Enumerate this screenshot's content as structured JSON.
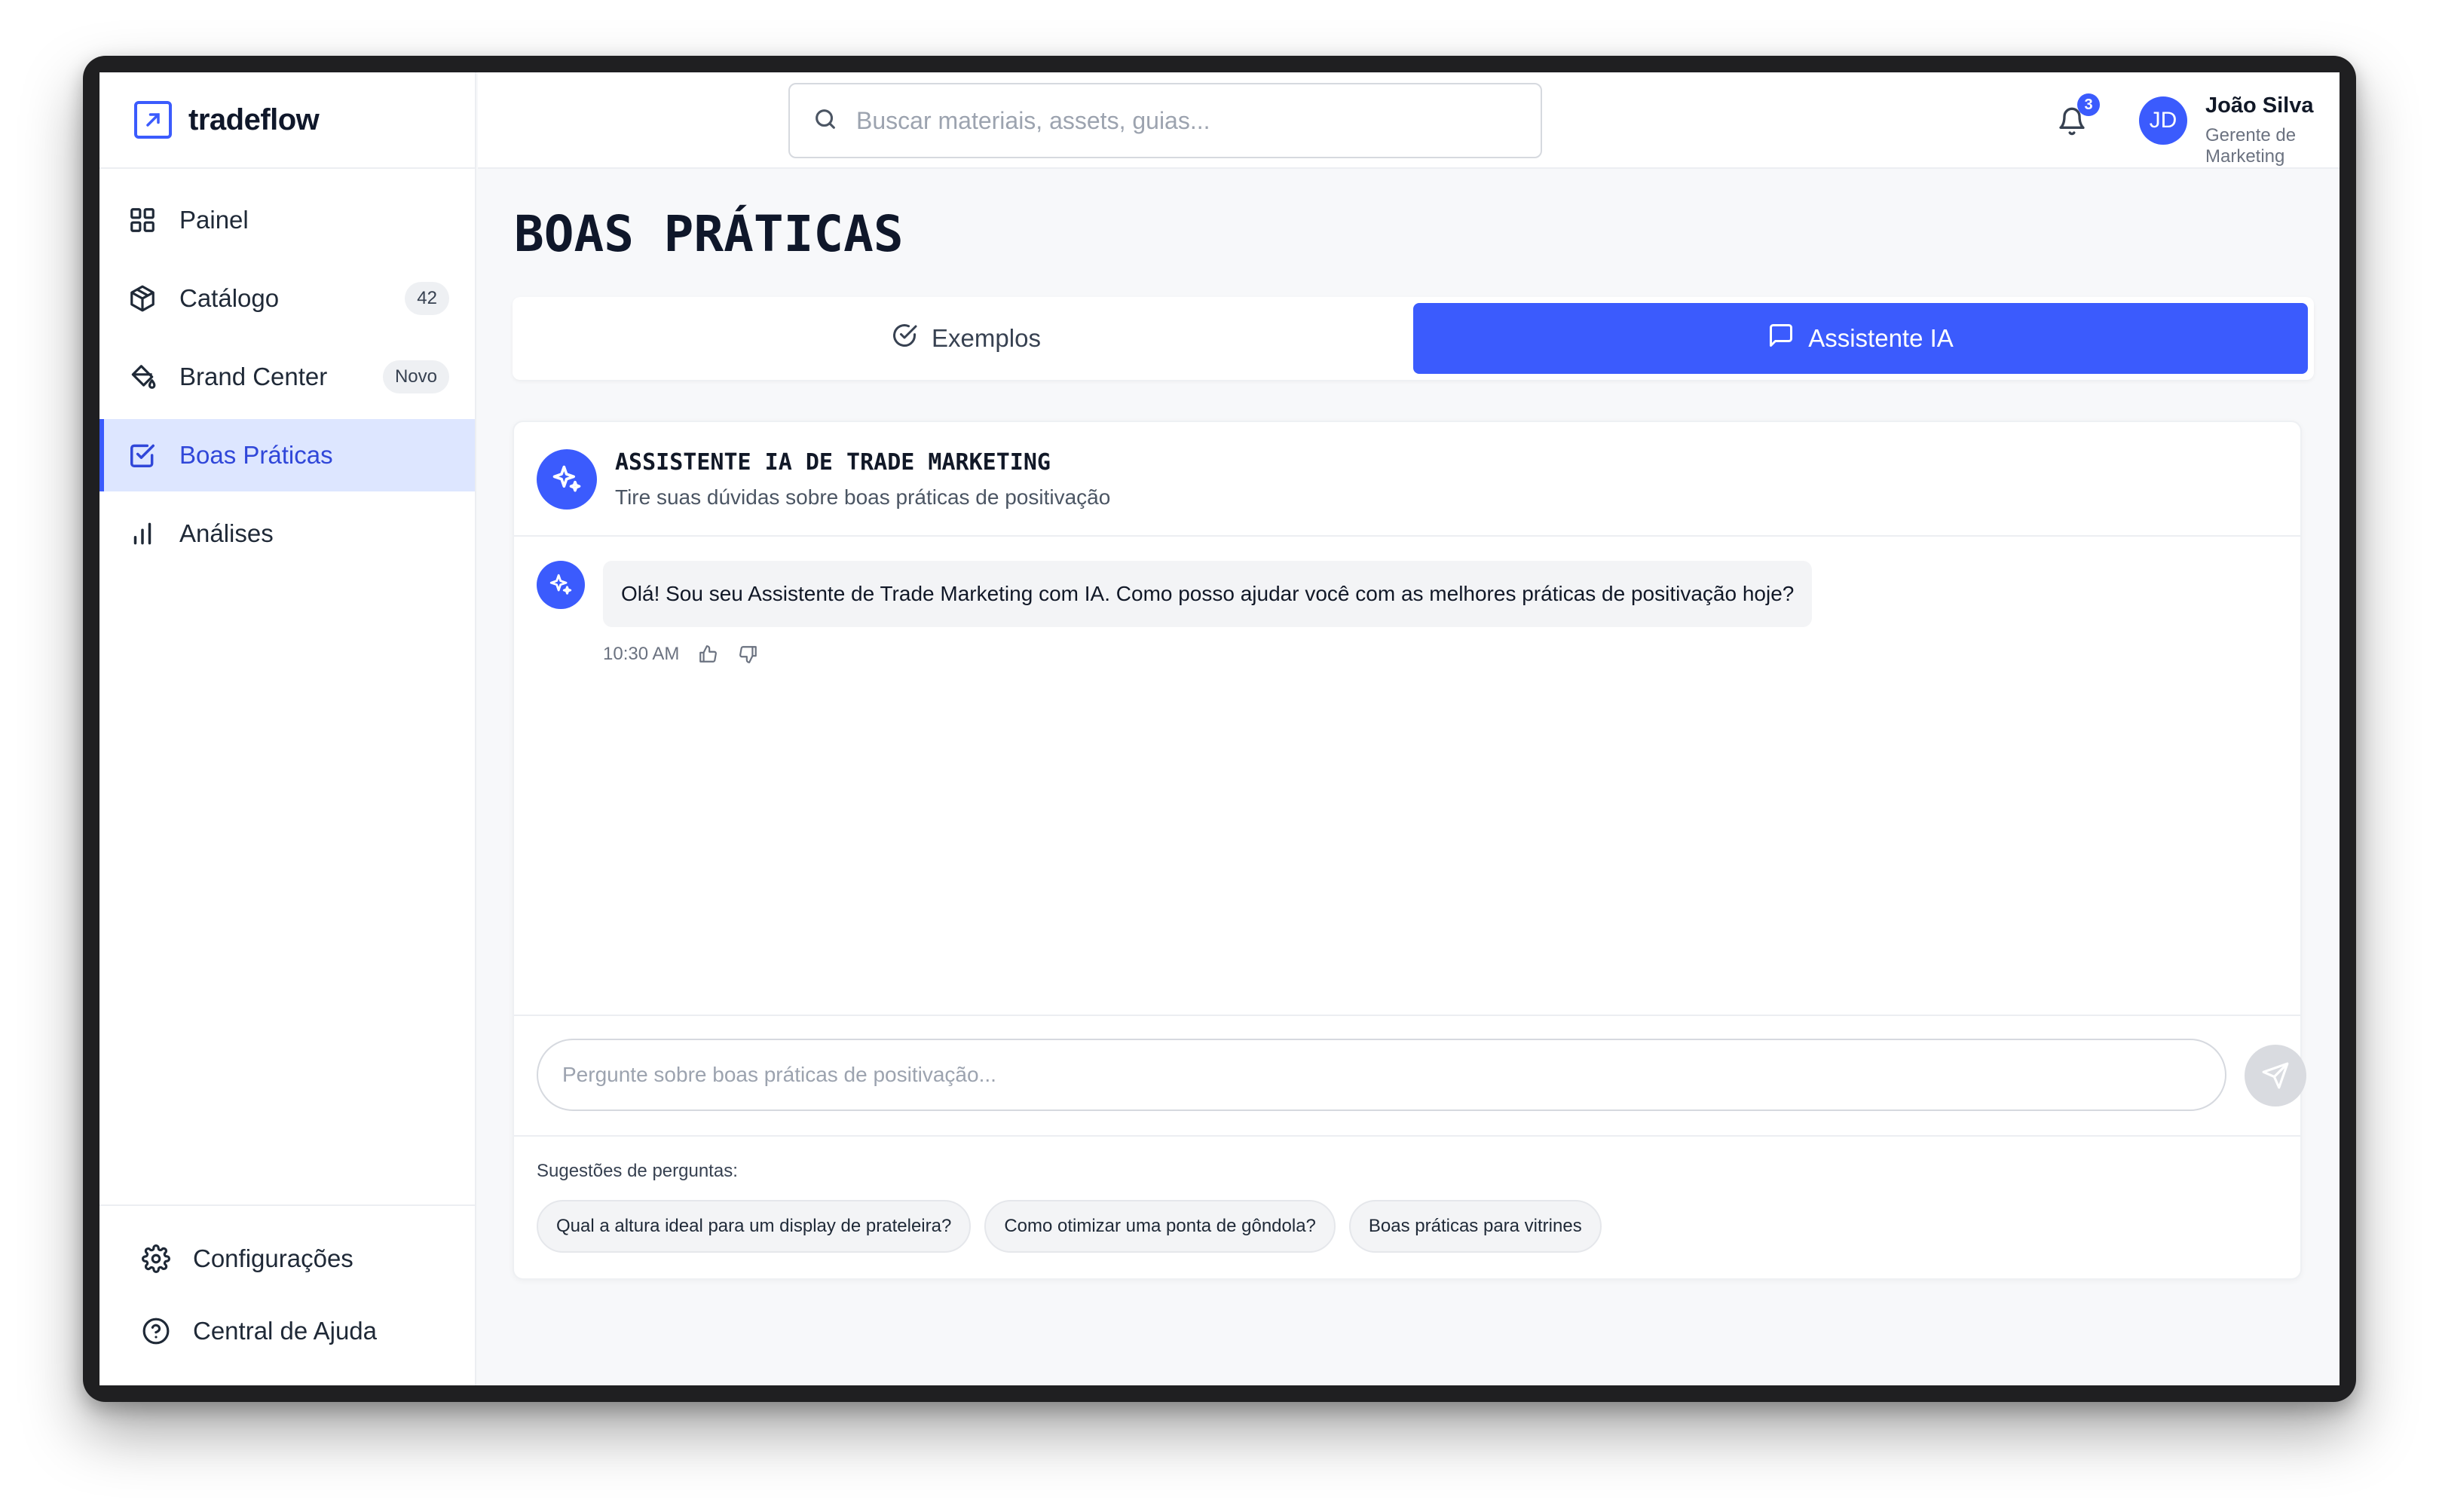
{
  "app": {
    "name": "tradeflow"
  },
  "sidebar": {
    "items": [
      {
        "label": "Painel",
        "icon": "grid-icon",
        "badge": ""
      },
      {
        "label": "Catálogo",
        "icon": "box-icon",
        "badge": "42"
      },
      {
        "label": "Brand Center",
        "icon": "paint-bucket-icon",
        "badge": "Novo"
      },
      {
        "label": "Boas Práticas",
        "icon": "check-square-icon",
        "badge": "",
        "active": true
      },
      {
        "label": "Análises",
        "icon": "bar-chart-icon",
        "badge": ""
      }
    ],
    "bottom": [
      {
        "label": "Configurações",
        "icon": "gear-icon"
      },
      {
        "label": "Central de Ajuda",
        "icon": "help-circle-icon"
      }
    ]
  },
  "header": {
    "search_placeholder": "Buscar materiais, assets, guias...",
    "notifications": "3",
    "user": {
      "initials": "JD",
      "name": "João Silva",
      "role": "Gerente de Marketing"
    }
  },
  "page": {
    "title": "BOAS PRÁTICAS"
  },
  "tabs": [
    {
      "label": "Exemplos",
      "icon": "check-circle-icon",
      "active": false
    },
    {
      "label": "Assistente IA",
      "icon": "message-square-icon",
      "active": true
    }
  ],
  "assistant": {
    "title": "ASSISTENTE IA DE TRADE MARKETING",
    "subtitle": "Tire suas dúvidas sobre boas práticas de positivação",
    "messages": [
      {
        "text": "Olá! Sou seu Assistente de Trade Marketing com IA. Como posso ajudar você com as melhores práticas de positivação hoje?",
        "time": "10:30 AM"
      }
    ],
    "input_placeholder": "Pergunte sobre boas práticas de positivação...",
    "suggestions_label": "Sugestões de perguntas:",
    "suggestions": [
      "Qual a altura ideal para um display de prateleira?",
      "Como otimizar uma ponta de gôndola?",
      "Boas práticas para vitrines"
    ]
  },
  "colors": {
    "accent": "#3b5bfd",
    "active_bg": "#dde6ff",
    "background": "#f7f8fa"
  }
}
